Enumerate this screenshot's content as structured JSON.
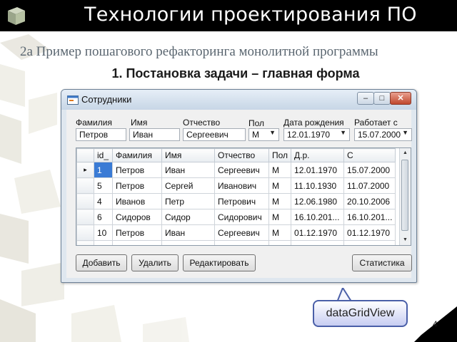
{
  "slide": {
    "title": "Технологии проектирования ПО",
    "subtitle": "2a Пример пошагового рефакторинга монолитной программы",
    "heading": "1. Постановка задачи – главная форма",
    "page_number": "4",
    "callout": "dataGridView"
  },
  "window": {
    "title": "Сотрудники",
    "controls": {
      "minimize": "–",
      "maximize": "□",
      "close": "✕"
    }
  },
  "filters": {
    "surname_label": "Фамилия",
    "name_label": "Имя",
    "patronymic_label": "Отчество",
    "gender_label": "Пол",
    "birthdate_label": "Дата рождения",
    "works_since_label": "Работает с",
    "surname_value": "Петров",
    "name_value": "Иван",
    "patronymic_value": "Сергеевич",
    "gender_value": "М",
    "birthdate_value": "12.01.1970",
    "works_since_value": "15.07.2000"
  },
  "grid": {
    "columns": [
      "id_",
      "Фамилия",
      "Имя",
      "Отчество",
      "Пол",
      "Д.р.",
      "С"
    ],
    "rows": [
      [
        "1",
        "Петров",
        "Иван",
        "Сергеевич",
        "М",
        "12.01.1970",
        "15.07.2000"
      ],
      [
        "5",
        "Петров",
        "Сергей",
        "Иванович",
        "М",
        "11.10.1930",
        "11.07.2000"
      ],
      [
        "4",
        "Иванов",
        "Петр",
        "Петрович",
        "М",
        "12.06.1980",
        "20.10.2006"
      ],
      [
        "6",
        "Сидоров",
        "Сидор",
        "Сидорович",
        "М",
        "16.10.201...",
        "16.10.201..."
      ],
      [
        "10",
        "Петров",
        "Иван",
        "Сергеевич",
        "М",
        "01.12.1970",
        "01.12.1970"
      ]
    ],
    "current_row_marker": "▸",
    "new_row_marker": "*"
  },
  "buttons": {
    "add": "Добавить",
    "delete": "Удалить",
    "edit": "Редактировать",
    "stats": "Статистика"
  },
  "colors": {
    "title_bar": "#000000",
    "selected_cell": "#3a7bd5",
    "window_border": "#6d8196",
    "callout_border": "#4a5fa8"
  }
}
